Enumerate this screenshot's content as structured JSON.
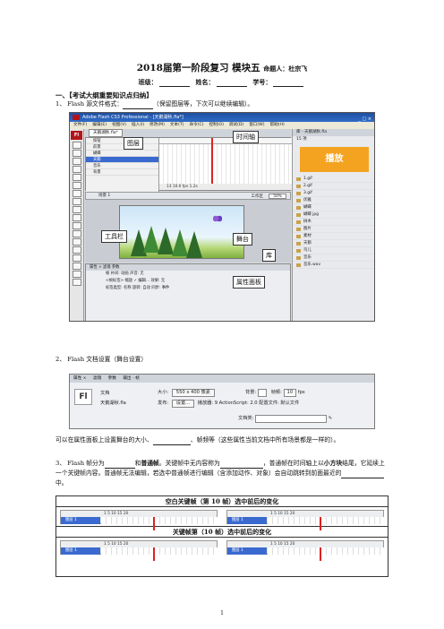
{
  "header": {
    "title": "2018届第一阶段复习 模块五",
    "author": "命题人：杜宗飞",
    "class_label": "班级：",
    "name_label": "姓名：",
    "number_label": "学号："
  },
  "section1": "一、【考试大纲重要知识点归纳】",
  "item1": {
    "num": "1、",
    "text": "Flash 源文件格式：",
    "hint": "（保留图层等，下次可以继续编辑）。"
  },
  "fig1": {
    "window_title": "Adobe Flash CS3 Professional - [天鹅湖秋.fla*]",
    "menu": [
      "文件(F)",
      "编辑(E)",
      "视图(V)",
      "插入(I)",
      "修改(M)",
      "文本(T)",
      "命令(C)",
      "控制(O)",
      "调试(D)",
      "窗口(W)",
      "帮助(H)"
    ],
    "doc_tab": "天鹅湖秋.fla*",
    "layers": [
      "按钮",
      "前景",
      "蝴蝶",
      "天鹅",
      "音乐",
      "背景"
    ],
    "selected_layer": "天鹅",
    "timeline_status": "13  10.0 fps  1.2s",
    "stage_bar": "场景 1",
    "zoom": "50%",
    "workspace": "工作区",
    "props_tabs": "属性 × 滤镜 参数",
    "props_rows": [
      "帧 补间: 动画  声音: 无",
      "<帧标签> 缩放 ✓ 编辑...  效果: 无",
      "标签类型: 名称  旋转: 自动  同步: 事件"
    ],
    "right_head": "库 - 天鹅湖秋.fla",
    "library_count": "15 项",
    "preview_text": "播放",
    "library_items": [
      "1.gif",
      "2.gif",
      "3.gif",
      "优雅",
      "蝴蝶",
      "蝴蝶 jpg",
      "树木",
      "图片",
      "素材",
      "天鹅",
      "鸟儿",
      "音乐",
      "音乐.wav"
    ],
    "callouts": {
      "timeline": "时间轴",
      "layer": "图层",
      "toolbox": "工具栏",
      "stage": "舞台",
      "library": "库",
      "props": "属性面板"
    }
  },
  "item2": {
    "num": "2、",
    "text": "Flash 文档设置（舞台设置）"
  },
  "fig2": {
    "tabs": [
      "属性 ×",
      "滤镜",
      "参数",
      "输出 - 帧"
    ],
    "doc_label": "文档",
    "doc_name": "天鹅湖秋.fla",
    "size_label": "大小:",
    "size_value": "550 x 400 像素",
    "bg_label": "背景:",
    "fps_label": "帧频:",
    "fps_value": "10",
    "fps_unit": "fps",
    "publish_label": "发布:",
    "settings_btn": "设置...",
    "player_text": "播放器: 9  ActionScript: 2.0  配置文件: 默认文件",
    "doc_class_label": "文档类:"
  },
  "para_after_fig2": "可以在属性面板上设置舞台的大小、",
  "para_after_fig2_b": "、帧频等（这些属性当前文档中所有场景都是一样的）。",
  "item3": {
    "num": "3、",
    "t1": "Flash 帧分为",
    "t2": "和",
    "t3": "普通帧",
    "t4": "。关键帧中无内容称为",
    "t5": "，普通帧在时间轴上以",
    "t6": "小方块",
    "t7": "结尾，它延续上一个关键帧内容。普通帧无法编辑，若选中普通帧进行编辑（含添加动作、对象）会自动跳转到前面最近的",
    "t8": "中。"
  },
  "fig3": {
    "row1_title": "空白关键帧（第 10 帧）选中前后的变化",
    "row2_title": "关键帧第（10 帧）选中前后的变化",
    "layer_label": "图层 1",
    "ruler": "1    5    10    15    20"
  },
  "page_number": "1"
}
